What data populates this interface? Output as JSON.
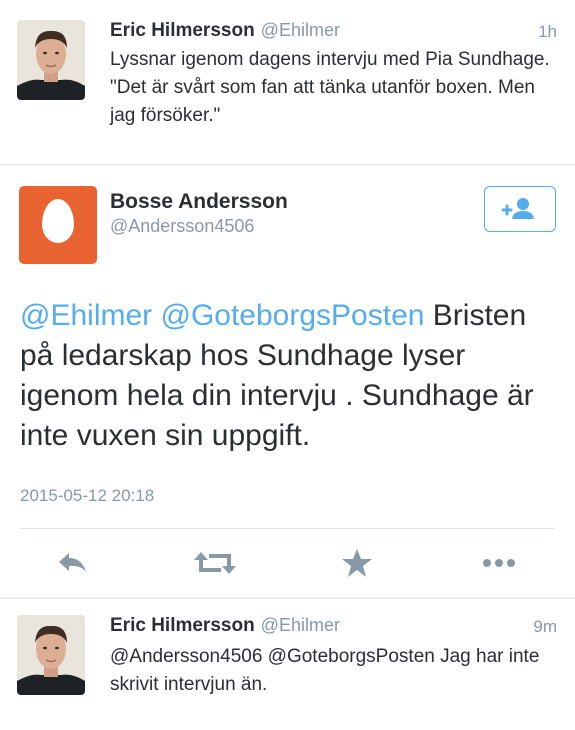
{
  "tweets": [
    {
      "name": "Eric Hilmersson",
      "handle": "@Ehilmer",
      "time": "1h",
      "text": "Lyssnar igenom dagens intervju med Pia Sundhage. \"Det är svårt som fan att tänka utanför boxen. Men jag försöker.\""
    },
    {
      "name": "Eric Hilmersson",
      "handle": "@Ehilmer",
      "time": "9m",
      "text": "@Andersson4506 @GoteborgsPosten Jag har inte skrivit intervjun än."
    }
  ],
  "detail": {
    "name": "Bosse Andersson",
    "handle": "@Andersson4506",
    "mention_1": "@Ehilmer",
    "mention_2": "@GoteborgsPosten",
    "body": "Bristen på ledarskap hos Sundhage lyser igenom hela din intervju . Sundhage är inte vuxen sin uppgift.",
    "date": "2015-05-12 20:18",
    "actions": [
      "reply-icon",
      "retweet-icon",
      "favorite-icon",
      "more-icon"
    ]
  },
  "colors": {
    "accent": "#55acee",
    "avatar_orange": "#e8632f",
    "action_gray": "#8899a6"
  }
}
